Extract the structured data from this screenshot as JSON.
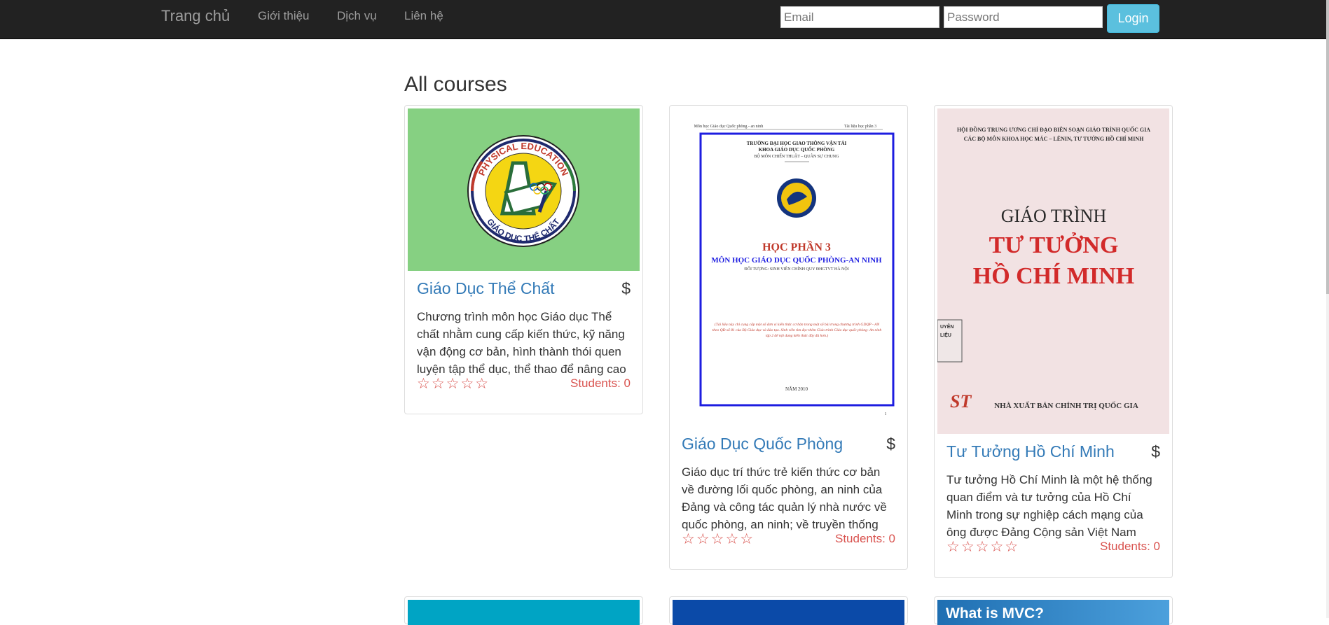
{
  "nav": {
    "brand": "Trang chủ",
    "links": [
      "Giới thiệu",
      "Dịch vụ",
      "Liên hệ"
    ],
    "email_placeholder": "Email",
    "password_placeholder": "Password",
    "login_label": "Login"
  },
  "page": {
    "heading": "All courses"
  },
  "courses": [
    {
      "title": "Giáo Dục Thể Chất",
      "price": "$",
      "description": "Chương trình môn học Giáo dục Thể chất nhằm cung cấp kiến thức, kỹ năng vận động cơ bản, hình thành thói quen luyện tập thể dục, thể thao để nâng cao sức khỏe",
      "stars": "☆☆☆☆☆",
      "students": "Students: 0",
      "image": {
        "badge_top": "PHYSICAL EDUCATION",
        "badge_bottom": "GIÁO DỤC THỂ CHẤT"
      }
    },
    {
      "title": "Giáo Dục Quốc Phòng",
      "price": "$",
      "description": "Giáo dục trí thức trẻ kiến thức cơ bản về đường lối quốc phòng, an ninh của Đảng và công tác quản lý nhà nước về quốc phòng, an ninh; về truyền thống",
      "stars": "☆☆☆☆☆",
      "students": "Students: 0",
      "image": {
        "header_left": "Môn học Giáo dục Quốc phòng - an ninh",
        "header_right": "Tài liệu học phần 3",
        "school": "TRƯỜNG ĐẠI HỌC GIAO THÔNG VẬN TẢI",
        "faculty": "KHOA GIÁO DỤC QUỐC PHÒNG",
        "department": "BỘ MÔN CHIẾN THUẬT – QUÂN SỰ CHUNG",
        "module": "HỌC PHẦN 3",
        "subject": "MÔN HỌC GIÁO DỤC QUỐC PHÒNG-AN NINH",
        "audience": "ĐỐI TƯỢNG: SINH VIÊN CHÍNH QUY ĐHGTVT HÀ NỘI",
        "note": "(Tài liệu này chỉ cung cấp một số đơn vị kiến thức cơ bản trong một số bài trong chương trình GDQP - AN theo QĐ số 81 của Bộ Giáo dục và đào tạo. Sinh viên tìm đọc thêm Giáo trình Giáo dục quốc phòng- An ninh tập 2 để nội dung kiến thức đầy đủ hơn.)",
        "year": "NĂM 2010",
        "page_number": "1"
      }
    },
    {
      "title": "Tư Tưởng Hồ Chí Minh",
      "price": "$",
      "description": "Tư tưởng Hồ Chí Minh là một hệ thống quan điểm và tư tưởng của Hồ Chí Minh trong sự nghiệp cách mạng của ông được Đảng Cộng sản Việt Nam",
      "stars": "☆☆☆☆☆",
      "students": "Students: 0",
      "image": {
        "council_line1": "HỘI ĐỒNG TRUNG ƯƠNG CHỈ ĐẠO BIÊN SOẠN GIÁO TRÌNH QUỐC GIA",
        "council_line2": "CÁC BỘ MÔN KHOA HỌC MÁC – LÊNIN, TƯ TƯỞNG HỒ CHÍ MINH",
        "book_type": "GIÁO TRÌNH",
        "book_title_1": "TƯ TƯỞNG",
        "book_title_2": "HỒ CHÍ MINH",
        "stamp_1": "UYÊN",
        "stamp_2": "LIỆU",
        "publisher_mark": "ST",
        "publisher": "NHÀ XUẤT BẢN CHÍNH TRỊ QUỐC GIA"
      }
    }
  ],
  "next_row": {
    "mvc_text": "What is MVC?"
  },
  "colors": {
    "navbar": "#222222",
    "link": "#337ab7",
    "accent": "#d9534f",
    "login": "#5bc0de"
  }
}
